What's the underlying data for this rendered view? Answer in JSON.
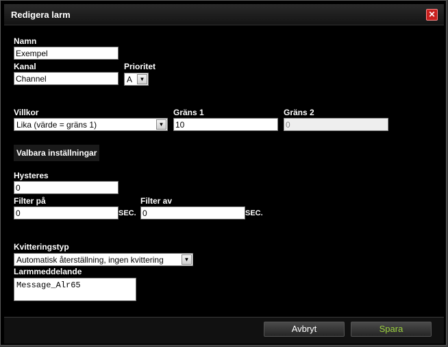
{
  "dialog": {
    "title": "Redigera larm"
  },
  "form": {
    "name": {
      "label": "Namn",
      "value": "Exempel"
    },
    "channel": {
      "label": "Kanal",
      "value": "Channel"
    },
    "priority": {
      "label": "Prioritet",
      "value": "A"
    },
    "condition": {
      "label": "Villkor",
      "value": "Lika (värde = gräns 1)"
    },
    "limit1": {
      "label": "Gräns 1",
      "value": "10"
    },
    "limit2": {
      "label": "Gräns 2",
      "value": "0"
    },
    "optional_header": "Valbara inställningar",
    "hysteresis": {
      "label": "Hysteres",
      "value": "0"
    },
    "filter_on": {
      "label": "Filter på",
      "value": "0",
      "unit": "SEC."
    },
    "filter_off": {
      "label": "Filter av",
      "value": "0",
      "unit": "SEC."
    },
    "ack_type": {
      "label": "Kvitteringstyp",
      "value": "Automatisk återställning, ingen kvittering"
    },
    "message": {
      "label": "Larmmeddelande",
      "value": "Message_Alr65"
    }
  },
  "footer": {
    "cancel_label": "Avbryt",
    "save_label": "Spara"
  },
  "icons": {
    "close": "close-icon",
    "dropdown": "chevron-down-icon"
  },
  "colors": {
    "save_text": "#9cd23e",
    "close_bg": "#c8201e",
    "background": "#000000"
  }
}
